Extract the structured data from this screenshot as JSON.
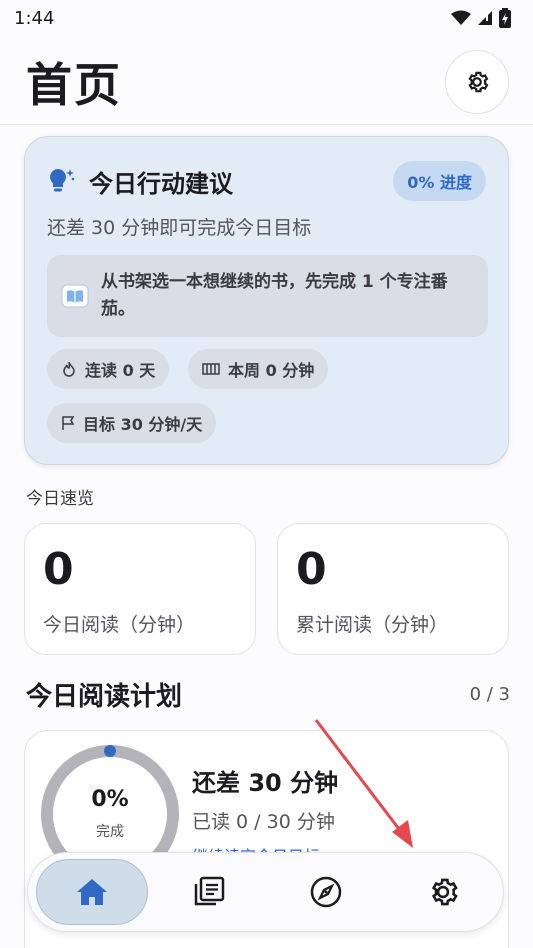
{
  "status_bar": {
    "time": "1:44"
  },
  "header": {
    "title": "首页"
  },
  "suggestion": {
    "title": "今日行动建议",
    "progress_badge": "0% 进度",
    "subtitle": "还差 30 分钟即可完成今日目标",
    "tip": "从书架选一本想继续的书，先完成 1 个专注番茄。",
    "chips": {
      "streak": "连读 0 天",
      "week": "本周 0 分钟",
      "goal": "目标 30 分钟/天"
    }
  },
  "overview": {
    "label": "今日速览",
    "today": {
      "value": "0",
      "label": "今日阅读（分钟）"
    },
    "total": {
      "value": "0",
      "label": "累计阅读（分钟）"
    }
  },
  "plan": {
    "title": "今日阅读计划",
    "count": "0 / 3",
    "ring_percent": "0%",
    "ring_label": "完成",
    "progress_fraction": 0,
    "remaining": "还差 30 分钟",
    "read": "已读 0 / 30 分钟",
    "link": "继续读完今日目标"
  },
  "nav": {
    "items": [
      "home-icon",
      "library-icon",
      "compass-icon",
      "gear-icon"
    ],
    "active": "home"
  },
  "colors": {
    "accent": "#2f69c4",
    "annotation_arrow": "#e5484d"
  }
}
